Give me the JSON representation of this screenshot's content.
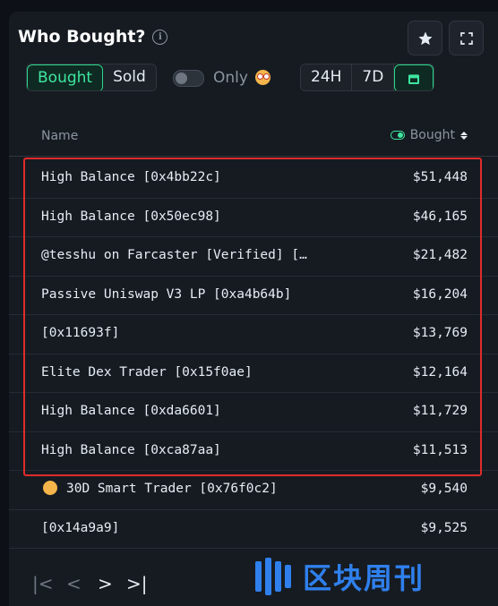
{
  "header": {
    "title": "Who Bought?"
  },
  "tabs": {
    "bought": "Bought",
    "sold": "Sold"
  },
  "filter": {
    "only_label": "Only"
  },
  "range": {
    "h24": "24H",
    "d7": "7D"
  },
  "table": {
    "col_name": "Name",
    "col_bought": "Bought",
    "rows": [
      {
        "name": "High Balance [0x4bb22c]",
        "value": "$51,448"
      },
      {
        "name": "High Balance [0x50ec98]",
        "value": "$46,165"
      },
      {
        "name": "@tesshu on Farcaster [Verified] […",
        "value": "$21,482"
      },
      {
        "name": "Passive Uniswap V3 LP [0xa4b64b]",
        "value": "$16,204"
      },
      {
        "name": "[0x11693f]",
        "value": "$13,769"
      },
      {
        "name": "Elite Dex Trader [0x15f0ae]",
        "value": "$12,164"
      },
      {
        "name": "High Balance [0xda6601]",
        "value": "$11,729"
      },
      {
        "name": "High Balance [0xca87aa]",
        "value": "$11,513"
      },
      {
        "name": "30D Smart Trader [0x76f0c2]",
        "value": "$9,540"
      },
      {
        "name": "[0x14a9a9]",
        "value": "$9,525"
      }
    ]
  },
  "pagination": {
    "first": "|<",
    "prev": "<",
    "next": ">",
    "last": ">|"
  },
  "watermark": {
    "text": "区块周刊"
  },
  "colors": {
    "accent": "#3ee6a0",
    "highlight": "#e02b2b",
    "watermark": "#2f80ed"
  },
  "icons": [
    "info-icon",
    "star-icon",
    "expand-icon",
    "calendar-icon",
    "toggle-icon",
    "emoji-face-icon",
    "sort-icon"
  ]
}
